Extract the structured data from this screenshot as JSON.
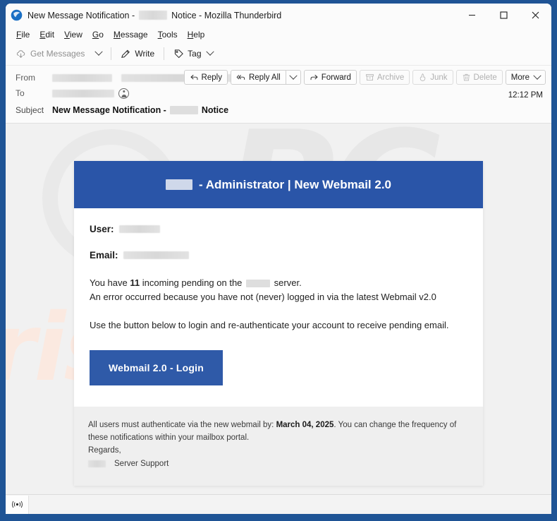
{
  "window": {
    "title_prefix": "New Message Notification -",
    "title_suffix": "Notice - Mozilla Thunderbird",
    "logo_icon": "thunderbird-logo-icon",
    "minimize_label": "─",
    "maximize_label": "☐",
    "close_label": "✕"
  },
  "menubar": {
    "items": [
      {
        "label": "File",
        "accel": "F"
      },
      {
        "label": "Edit",
        "accel": "E"
      },
      {
        "label": "View",
        "accel": "V"
      },
      {
        "label": "Go",
        "accel": "G"
      },
      {
        "label": "Message",
        "accel": "M"
      },
      {
        "label": "Tools",
        "accel": "T"
      },
      {
        "label": "Help",
        "accel": "H"
      }
    ]
  },
  "toolbar": {
    "get_messages_label": "Get Messages",
    "get_messages_icon": "download-cloud-icon",
    "get_messages_chevron_icon": "chevron-down-icon",
    "write_label": "Write",
    "write_icon": "pencil-icon",
    "tag_label": "Tag",
    "tag_icon": "tag-icon",
    "tag_chevron_icon": "chevron-down-icon"
  },
  "message_header": {
    "from_label": "From",
    "from_value_redacted": true,
    "to_label": "To",
    "to_value_redacted": true,
    "subject_label": "Subject",
    "subject_prefix": "New Message Notification -",
    "subject_suffix": "Notice",
    "timestamp": "12:12 PM",
    "contact_icon": "contact-person-icon",
    "actions": [
      {
        "label": "Reply",
        "icon": "reply-arrow-icon",
        "disabled": false
      },
      {
        "label": "Reply All",
        "icon": "reply-all-arrow-icon",
        "disabled": false,
        "has_dropdown": true,
        "dropdown_icon": "chevron-down-icon"
      },
      {
        "label": "Forward",
        "icon": "forward-arrow-icon",
        "disabled": false
      },
      {
        "label": "Archive",
        "icon": "archive-box-icon",
        "disabled": true
      },
      {
        "label": "Junk",
        "icon": "junk-flame-icon",
        "disabled": true
      },
      {
        "label": "Delete",
        "icon": "trash-can-icon",
        "disabled": true
      },
      {
        "label": "More",
        "icon": "chevron-down-icon",
        "disabled": false
      }
    ]
  },
  "email": {
    "banner_prefix_redacted": true,
    "banner_text": "- Administrator | New Webmail 2.0",
    "user_label": "User:",
    "user_value_redacted": true,
    "email_label": "Email:",
    "email_value_redacted": true,
    "line1_before": "You have",
    "line1_count": "11",
    "line1_mid": "incoming pending on the",
    "line1_after": "server.",
    "line2": "An error occurred because you have not (never) logged in via the latest Webmail v2.0",
    "line3": "Use the button below to login and re-authenticate your account to receive pending email.",
    "cta_label": "Webmail 2.0 - Login",
    "footer_before": "All users must authenticate via the new webmail by:",
    "footer_date": "March 04, 2025",
    "footer_after": ". You can change the frequency of these notifications within your mailbox portal.",
    "regards": "Regards,",
    "signature": "Server Support"
  },
  "watermark": {
    "brand_top": "PC",
    "brand_bottom": "risk.com",
    "glass_icon": "magnifying-glass-icon"
  },
  "statusbar": {
    "connection_icon": "broadcast-signal-icon"
  },
  "colors": {
    "window_border": "#1f5495",
    "banner_blue": "#2a55a8",
    "button_blue": "#2f5aa8",
    "body_bg": "#f1f1f1",
    "footer_bg": "#efefef"
  }
}
